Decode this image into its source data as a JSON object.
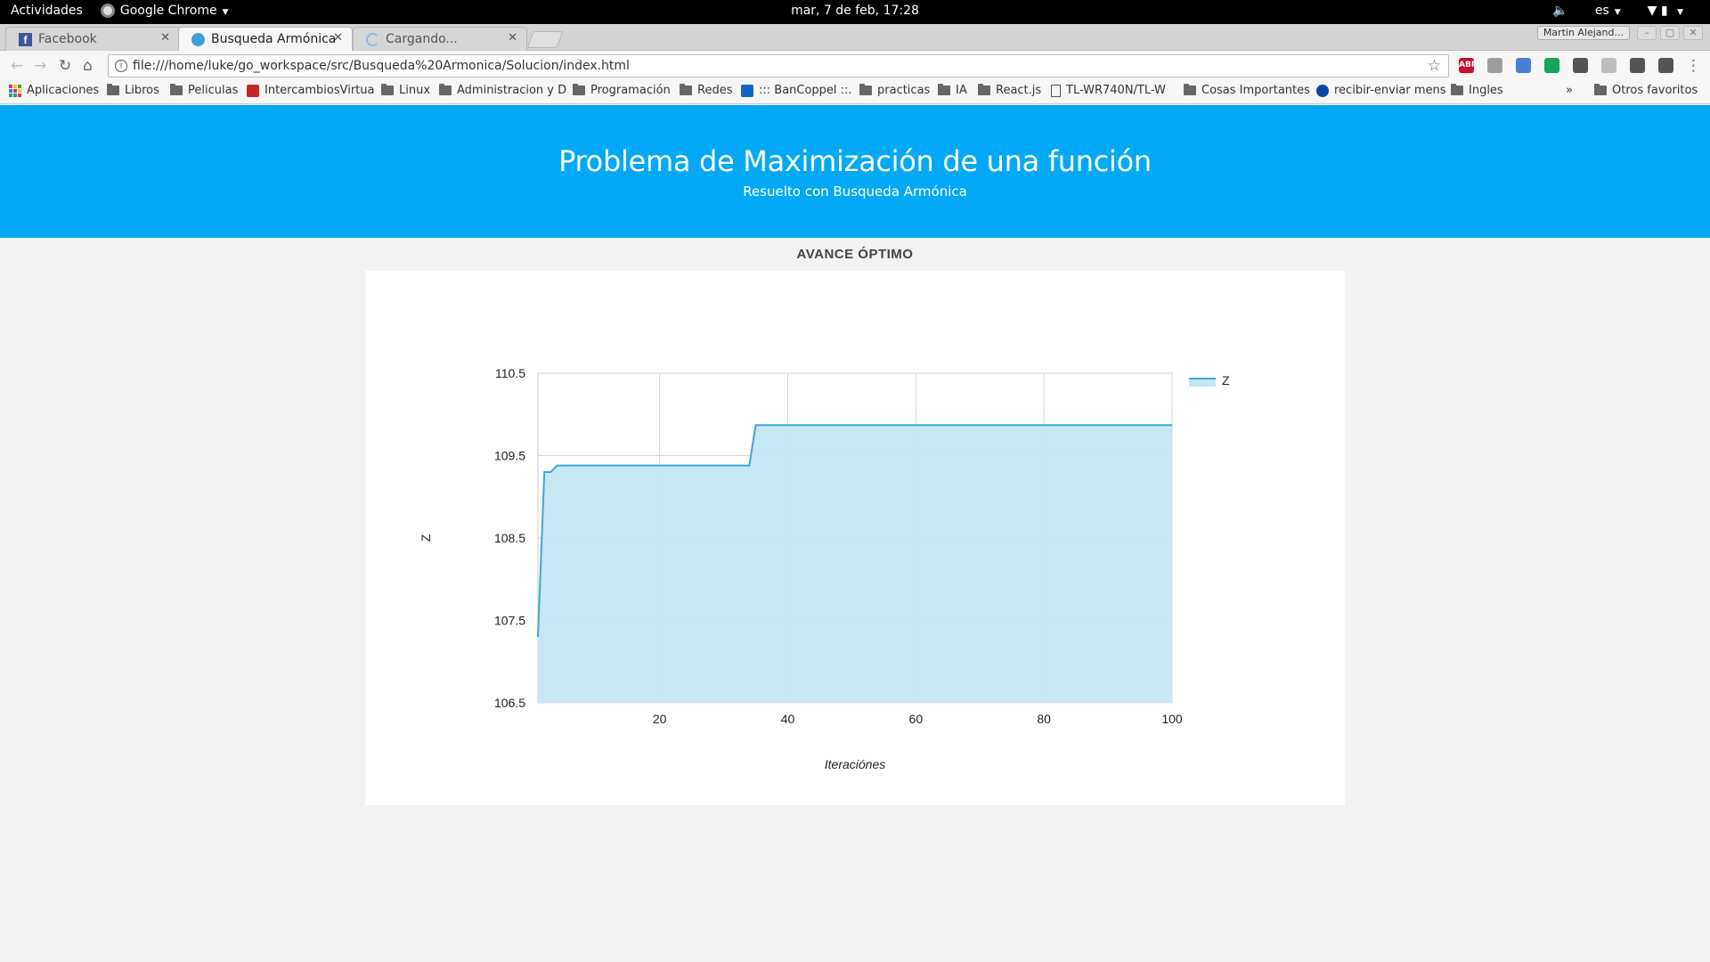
{
  "system_bar": {
    "activities": "Actividades",
    "app_name": "Google Chrome",
    "clock": "mar,  7 de feb, 17:28",
    "language": "es"
  },
  "tabs": [
    {
      "title": "Facebook",
      "icon": "facebook-icon",
      "active": false
    },
    {
      "title": "Busqueda Armónica",
      "icon": "page-icon",
      "active": true
    },
    {
      "title": "Cargando...",
      "icon": "loading-icon",
      "active": false
    }
  ],
  "profile_name": "Martin Alejand...",
  "address_bar": {
    "url": "file:///home/luke/go_workspace/src/Busqueda%20Armonica/Solucion/index.html"
  },
  "extensions": [
    {
      "name": "adblock-icon",
      "label": "ABP",
      "color": "#c70d2c"
    },
    {
      "name": "mail-icon",
      "label": "",
      "color": "#9e9e9e"
    },
    {
      "name": "translate-icon",
      "label": "",
      "color": "#4a7fd6"
    },
    {
      "name": "circle-green-icon",
      "label": "",
      "color": "#1aa260"
    },
    {
      "name": "eyedropper-icon",
      "label": "",
      "color": "#555555"
    },
    {
      "name": "m-icon",
      "label": "",
      "color": "#bdbdbd"
    },
    {
      "name": "shield-icon",
      "label": "",
      "color": "#555555"
    },
    {
      "name": "refresh-ext-icon",
      "label": "",
      "color": "#555555"
    }
  ],
  "bookmarks": [
    {
      "label": "Aplicaciones",
      "icon": "apps"
    },
    {
      "label": "Libros",
      "icon": "folder"
    },
    {
      "label": "Peliculas",
      "icon": "folder"
    },
    {
      "label": "IntercambiosVirtua",
      "icon": "iv"
    },
    {
      "label": "Linux",
      "icon": "folder"
    },
    {
      "label": "Administracion y D",
      "icon": "folder"
    },
    {
      "label": "Programación",
      "icon": "folder"
    },
    {
      "label": "Redes",
      "icon": "folder"
    },
    {
      "label": "::: BanCoppel ::.",
      "icon": "bancoppel"
    },
    {
      "label": "practicas",
      "icon": "folder"
    },
    {
      "label": "IA",
      "icon": "folder"
    },
    {
      "label": "React.js",
      "icon": "folder"
    },
    {
      "label": "TL-WR740N/TL-W",
      "icon": "page"
    },
    {
      "label": "Cosas Importantes",
      "icon": "folder"
    },
    {
      "label": "recibir-enviar mens",
      "icon": "globe"
    },
    {
      "label": "Ingles",
      "icon": "folder"
    }
  ],
  "bookmarks_overflow": "»",
  "other_bookmarks": "Otros favoritos",
  "header": {
    "title": "Problema de Maximización de una función",
    "subtitle": "Resuelto con Busqueda Armónica"
  },
  "section_title": "AVANCE ÓPTIMO",
  "colors": {
    "header_bg": "#03a9f4",
    "line": "#3aa8d8",
    "fill": "#c4e6f3"
  },
  "chart_data": {
    "type": "area",
    "title": "",
    "xlabel": "Iteraciónes",
    "ylabel": "Z",
    "legend": [
      "Z"
    ],
    "legend_position": "top-right",
    "grid": true,
    "xlim": [
      1,
      100
    ],
    "ylim": [
      106.5,
      110.5
    ],
    "xticks": [
      20,
      40,
      60,
      80,
      100
    ],
    "yticks": [
      106.5,
      107.5,
      108.5,
      109.5,
      110.5
    ],
    "series": [
      {
        "name": "Z",
        "x": [
          1,
          2,
          3,
          4,
          5,
          34,
          35,
          100
        ],
        "y": [
          107.3,
          109.3,
          109.3,
          109.38,
          109.38,
          109.38,
          109.87,
          109.87
        ]
      }
    ]
  }
}
